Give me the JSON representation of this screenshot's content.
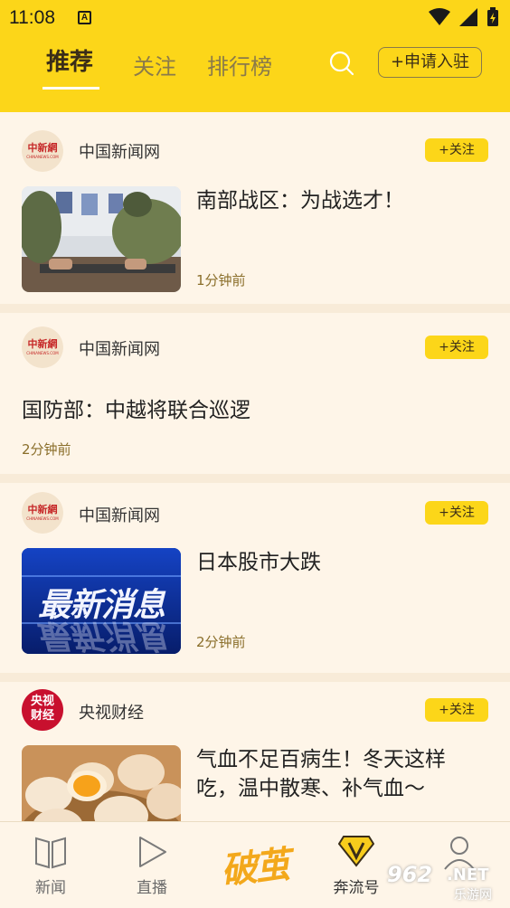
{
  "status": {
    "time": "11:08",
    "a_badge": "A"
  },
  "nav": {
    "tabs": [
      {
        "label": "推荐",
        "active": true
      },
      {
        "label": "关注",
        "active": false
      },
      {
        "label": "排行榜",
        "active": false
      }
    ],
    "apply_label": "+申请入驻"
  },
  "feed": [
    {
      "source": "中国新闻网",
      "follow": "+关注",
      "title": "南部战区：为战选才！",
      "time": "1分钟前",
      "logo": "chinanews-logo"
    },
    {
      "source": "中国新闻网",
      "follow": "+关注",
      "title": "国防部：中越将联合巡逻",
      "time": "2分钟前",
      "logo": "chinanews-logo"
    },
    {
      "source": "中国新闻网",
      "follow": "+关注",
      "title": "日本股市大跌",
      "time": "2分钟前",
      "logo": "chinanews-logo",
      "thumb_text": "最新消息"
    },
    {
      "source": "央视财经",
      "follow": "+关注",
      "title_line1": "气血不足百病生！冬天这样",
      "title_line2": "吃，温中散寒、补气血～",
      "logo": "cctv-finance-logo",
      "logo_text": [
        "央视",
        "财经"
      ]
    }
  ],
  "logo_text": {
    "chinanews": "中新網",
    "chinanews_sub": "CHINANEWS.COM"
  },
  "bottom_nav": [
    {
      "label": "新闻",
      "icon": "book-icon"
    },
    {
      "label": "直播",
      "icon": "play-icon"
    },
    {
      "label": "破茧",
      "icon": "pojian-logo"
    },
    {
      "label": "奔流号",
      "icon": "v-diamond-icon"
    },
    {
      "label": "",
      "icon": "person-icon"
    }
  ],
  "watermark": {
    "text": "962",
    "suffix": ".NET",
    "sub": "乐游网"
  },
  "colors": {
    "brand_yellow": "#FCD619",
    "background": "#FDF4E6",
    "time_color": "#8a6e2a"
  }
}
